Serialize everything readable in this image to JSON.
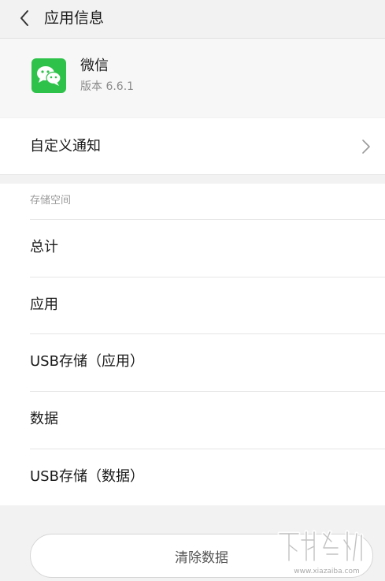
{
  "topbar": {
    "title": "应用信息",
    "back_icon": "chevron-left-icon"
  },
  "app": {
    "name": "微信",
    "version": "版本 6.6.1",
    "icon": "wechat-icon",
    "icon_color": "#2ec24a"
  },
  "notification": {
    "label": "自定义通知",
    "chevron_icon": "chevron-right-icon"
  },
  "storage": {
    "header": "存储空间",
    "rows": [
      {
        "label": "总计"
      },
      {
        "label": "应用"
      },
      {
        "label": "USB存储（应用）"
      },
      {
        "label": "数据"
      },
      {
        "label": "USB存储（数据）"
      }
    ]
  },
  "actions": {
    "clear_data_label": "清除数据"
  },
  "watermark": {
    "icon": "download-site-watermark",
    "text": "www.xiazaiba.com"
  }
}
